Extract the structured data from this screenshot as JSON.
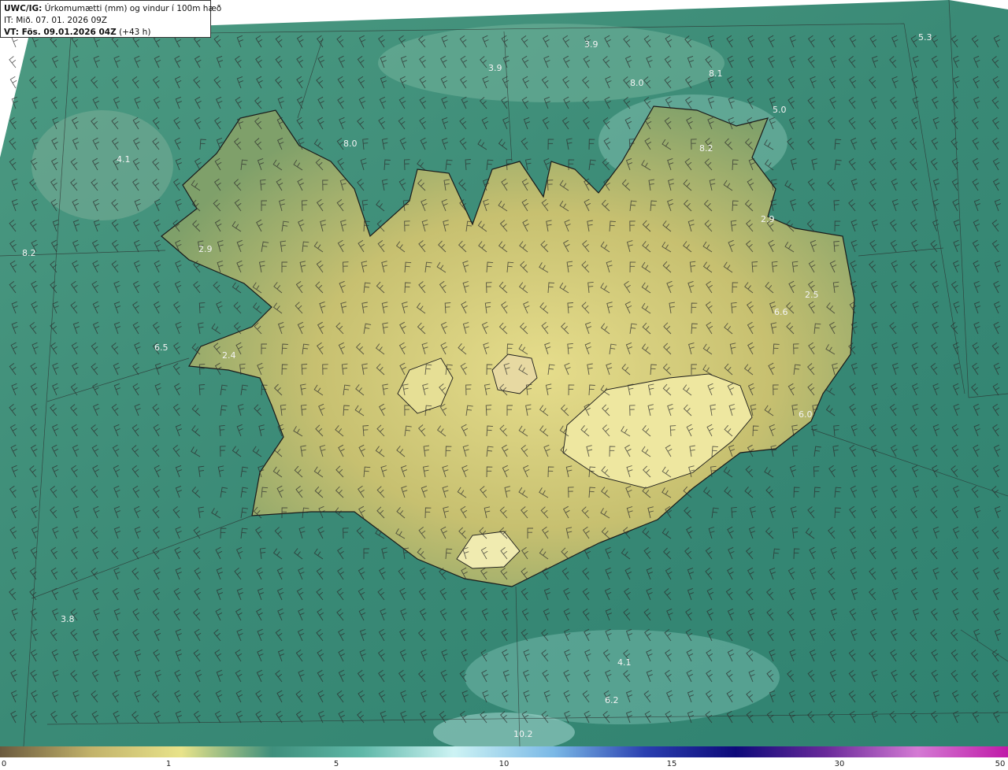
{
  "header": {
    "product": "UWC/IG:",
    "title": "Úrkomumætti (mm) og vindur í 100m hæð",
    "issue_time": "IT: Mið. 07. 01. 2026 09Z",
    "valid_label": "VT: Fös. 09.01.2026 04Z",
    "valid_offset": "(+43 h)"
  },
  "map": {
    "background_color": "#3a8a78",
    "land_color": "#c9c06a",
    "coast_color": "#1a1a1a",
    "barb_color": "#2b2b2b",
    "value_labels": [
      "3.9",
      "3.9",
      "8.0",
      "8.1",
      "5.3",
      "5.0",
      "4.1",
      "8.0",
      "8.2",
      "2.9",
      "8.2",
      "2.9",
      "2.5",
      "6.6",
      "6.5",
      "2.4",
      "6.0",
      "3.8",
      "6.2",
      "4.1",
      "10.2"
    ]
  },
  "colorbar": {
    "ticks": [
      "0",
      "1",
      "5",
      "10",
      "15",
      "30",
      "50"
    ],
    "colors": [
      "#6b5a3e",
      "#c2b26a",
      "#e8e38a",
      "#3f8f7c",
      "#5fb8a8",
      "#cdf3f4",
      "#7ab8e6",
      "#2a3fb0",
      "#0e0a7a",
      "#6a2a9a",
      "#d47ad4",
      "#c01aa8"
    ]
  }
}
